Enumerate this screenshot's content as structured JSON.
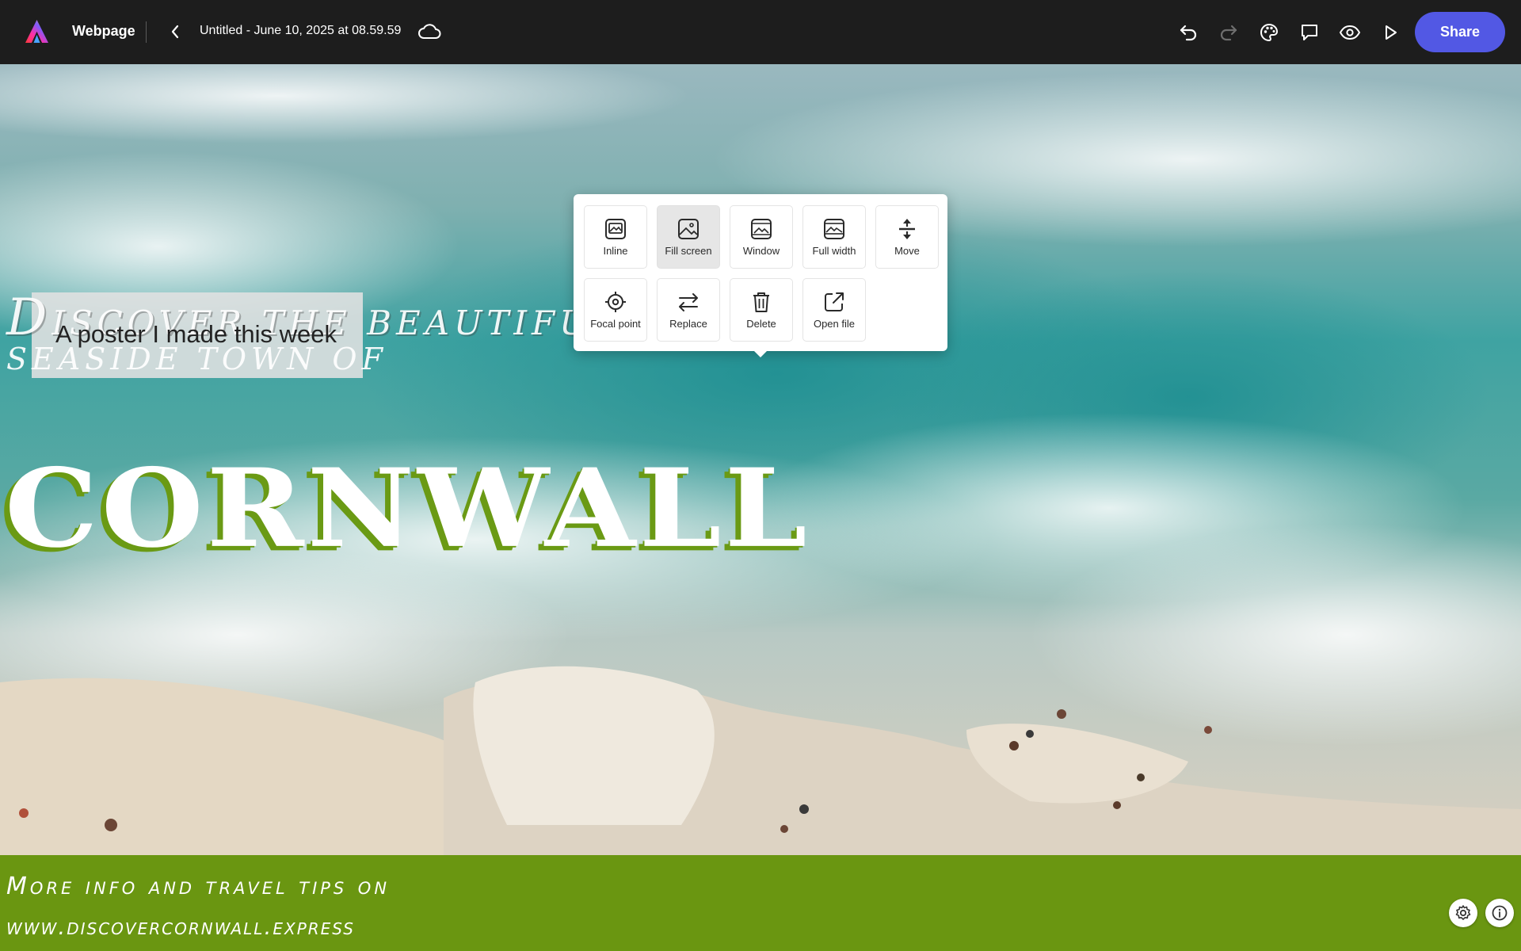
{
  "app": {
    "name": "Webpage",
    "document_title": "Untitled - June 10, 2025 at 08.59.59",
    "share_label": "Share"
  },
  "toolbar_icons": [
    "undo-icon",
    "redo-icon",
    "theme-palette-icon",
    "comment-icon",
    "preview-eye-icon",
    "play-icon"
  ],
  "colors": {
    "topbar": "#1d1d1d",
    "share_button": "#5258e4",
    "footer_band": "#6a9611",
    "cornwall_shadow": "#6a9a14"
  },
  "canvas": {
    "headline_line1_initial": "D",
    "headline_line1_rest": "iscover the beautiful",
    "headline_line2": "seaside town of",
    "caption": "A poster I made this week",
    "title": "CORNWALL",
    "footer_line1": "More info and travel tips on",
    "footer_line2": "www.discovercornwall.express"
  },
  "image_menu": {
    "items": [
      {
        "label": "Inline",
        "icon": "image-inline-icon",
        "selected": false
      },
      {
        "label": "Fill screen",
        "icon": "image-fill-screen-icon",
        "selected": true
      },
      {
        "label": "Window",
        "icon": "image-window-icon",
        "selected": false
      },
      {
        "label": "Full width",
        "icon": "image-full-width-icon",
        "selected": false
      },
      {
        "label": "Move",
        "icon": "move-arrows-icon",
        "selected": false
      },
      {
        "label": "Focal point",
        "icon": "focal-point-icon",
        "selected": false
      },
      {
        "label": "Replace",
        "icon": "replace-arrows-icon",
        "selected": false
      },
      {
        "label": "Delete",
        "icon": "trash-icon",
        "selected": false
      },
      {
        "label": "Open file",
        "icon": "open-external-icon",
        "selected": false
      }
    ]
  },
  "corner_controls": [
    "settings-gear-icon",
    "info-icon"
  ]
}
